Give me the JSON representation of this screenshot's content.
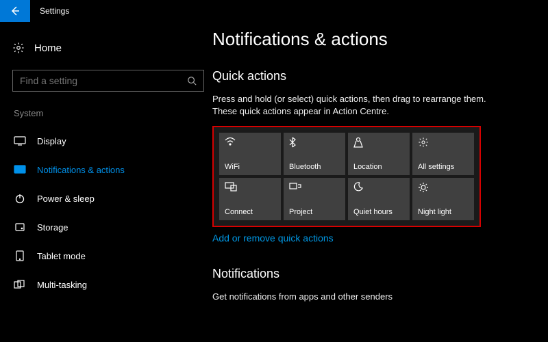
{
  "titlebar": {
    "title": "Settings"
  },
  "sidebar": {
    "home_label": "Home",
    "search_placeholder": "Find a setting",
    "category": "System",
    "items": [
      {
        "label": "Display"
      },
      {
        "label": "Notifications & actions"
      },
      {
        "label": "Power & sleep"
      },
      {
        "label": "Storage"
      },
      {
        "label": "Tablet mode"
      },
      {
        "label": "Multi-tasking"
      }
    ]
  },
  "main": {
    "heading": "Notifications & actions",
    "quick_actions": {
      "title": "Quick actions",
      "description": "Press and hold (or select) quick actions, then drag to rearrange them. These quick actions appear in Action Centre.",
      "tiles": [
        {
          "label": "WiFi"
        },
        {
          "label": "Bluetooth"
        },
        {
          "label": "Location"
        },
        {
          "label": "All settings"
        },
        {
          "label": "Connect"
        },
        {
          "label": "Project"
        },
        {
          "label": "Quiet hours"
        },
        {
          "label": "Night light"
        }
      ],
      "link": "Add or remove quick actions"
    },
    "notifications": {
      "title": "Notifications",
      "description": "Get notifications from apps and other senders"
    }
  }
}
